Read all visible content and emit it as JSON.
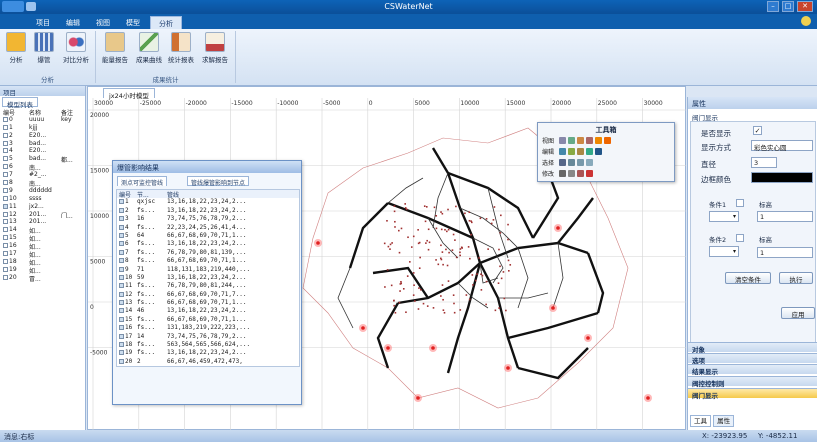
{
  "window": {
    "title": "CSWaterNet"
  },
  "tabs": [
    "项目",
    "编辑",
    "视图",
    "模型",
    "分析"
  ],
  "ribbon": {
    "buttons": [
      {
        "label": "分析",
        "icon": "analysis-icon",
        "color": "#f2b632"
      },
      {
        "label": "爆管",
        "icon": "pipe-burst-icon",
        "color": "#4a72b8"
      },
      {
        "label": "对比分析",
        "icon": "compare-icon",
        "color": "#d8486a"
      },
      {
        "label": "能量报告",
        "icon": "energy-report-icon",
        "color": "#e0a040"
      },
      {
        "label": "成果曲线",
        "icon": "result-curve-icon",
        "color": "#5aa050"
      },
      {
        "label": "统计报表",
        "icon": "stat-report-icon",
        "color": "#d07030"
      },
      {
        "label": "求解报告",
        "icon": "solve-report-icon",
        "color": "#c04040"
      }
    ],
    "groups": [
      "分析",
      "成果统计"
    ]
  },
  "left_panel": {
    "title": "项目",
    "tab": "模型列表",
    "headers": [
      "编号",
      "名称",
      "备注"
    ],
    "rows": [
      {
        "no": "0",
        "name": "uuuu",
        "note": "key",
        "checked": false
      },
      {
        "no": "1",
        "name": "kjjj",
        "note": "",
        "checked": false
      },
      {
        "no": "2",
        "name": "E20...",
        "note": "",
        "checked": false
      },
      {
        "no": "3",
        "name": "bad...",
        "note": "",
        "checked": false
      },
      {
        "no": "4",
        "name": "E20...",
        "note": "",
        "checked": false
      },
      {
        "no": "5",
        "name": "bad...",
        "note": "都...",
        "checked": false
      },
      {
        "no": "6",
        "name": "南...",
        "note": "",
        "checked": false
      },
      {
        "no": "7",
        "name": "#2_...",
        "note": "",
        "checked": false
      },
      {
        "no": "8",
        "name": "南...",
        "note": "",
        "checked": false
      },
      {
        "no": "9",
        "name": "dddddd",
        "note": "",
        "checked": false
      },
      {
        "no": "10",
        "name": "ssss",
        "note": "",
        "checked": false
      },
      {
        "no": "11",
        "name": "jx2...",
        "note": "",
        "checked": true
      },
      {
        "no": "12",
        "name": "201...",
        "note": "门...",
        "checked": false
      },
      {
        "no": "13",
        "name": "201...",
        "note": "",
        "checked": false
      },
      {
        "no": "14",
        "name": "如...",
        "note": "",
        "checked": false
      },
      {
        "no": "15",
        "name": "如...",
        "note": "",
        "checked": false
      },
      {
        "no": "16",
        "name": "如...",
        "note": "",
        "checked": false
      },
      {
        "no": "17",
        "name": "如...",
        "note": "",
        "checked": false
      },
      {
        "no": "18",
        "name": "如...",
        "note": "",
        "checked": false
      },
      {
        "no": "19",
        "name": "如...",
        "note": "",
        "checked": false
      },
      {
        "no": "20",
        "name": "冒...",
        "note": "",
        "checked": false
      }
    ]
  },
  "document": {
    "tab": "jx24小时模型",
    "x_ticks": [
      "30000",
      "-25000",
      "-20000",
      "-15000",
      "-10000",
      "-5000",
      "0",
      "5000",
      "10000",
      "15000",
      "20000",
      "25000",
      "30000",
      "35000"
    ],
    "y_ticks": [
      "20000",
      "15000",
      "10000",
      "5000",
      "0",
      "-5000"
    ]
  },
  "impact_panel": {
    "title": "爆管影响结果",
    "tabs": [
      "测点可监控管线",
      "管线爆管影响到节点"
    ],
    "headers": [
      "编号",
      "节...",
      "管线"
    ],
    "rows": [
      {
        "no": "1",
        "node": "qxjsc",
        "pipes": "13,16,18,22,23,24,2..."
      },
      {
        "no": "2",
        "node": "fs...",
        "pipes": "13,16,18,22,23,24,2..."
      },
      {
        "no": "3",
        "node": "16",
        "pipes": "73,74,75,76,78,79,2..."
      },
      {
        "no": "4",
        "node": "fs...",
        "pipes": "22,23,24,25,26,41,4..."
      },
      {
        "no": "5",
        "node": "64",
        "pipes": "66,67,68,69,70,71,1..."
      },
      {
        "no": "6",
        "node": "fs...",
        "pipes": "13,16,18,22,23,24,2..."
      },
      {
        "no": "7",
        "node": "fs...",
        "pipes": "76,78,79,80,81,139,..."
      },
      {
        "no": "8",
        "node": "fs...",
        "pipes": "66,67,68,69,70,71,1..."
      },
      {
        "no": "9",
        "node": "71",
        "pipes": "118,131,183,219,440,..."
      },
      {
        "no": "10",
        "node": "59",
        "pipes": "13,16,18,22,23,24,2..."
      },
      {
        "no": "11",
        "node": "fs...",
        "pipes": "76,78,79,80,81,244,..."
      },
      {
        "no": "12",
        "node": "fs...",
        "pipes": "66,67,68,69,70,71,7..."
      },
      {
        "no": "13",
        "node": "fs...",
        "pipes": "66,67,68,69,70,71,1..."
      },
      {
        "no": "14",
        "node": "46",
        "pipes": "13,16,18,22,23,24,2..."
      },
      {
        "no": "15",
        "node": "fs...",
        "pipes": "66,67,68,69,70,71,1..."
      },
      {
        "no": "16",
        "node": "fs...",
        "pipes": "131,183,219,222,223,..."
      },
      {
        "no": "17",
        "node": "14",
        "pipes": "73,74,75,76,78,79,2..."
      },
      {
        "no": "18",
        "node": "fs...",
        "pipes": "563,564,565,566,624,..."
      },
      {
        "no": "19",
        "node": "fs...",
        "pipes": "13,16,18,22,23,24,2..."
      },
      {
        "no": "20",
        "node": "2",
        "pipes": "66,67,46,459,472,473,"
      }
    ]
  },
  "toolbox": {
    "title": "工具箱",
    "rows": [
      "视图",
      "编辑",
      "选择",
      "修改"
    ]
  },
  "properties": {
    "title": "属性",
    "section": "阀门显示",
    "show_label": "是否显示",
    "show_mode_label": "显示方式",
    "show_mode_value": "彩色实心圆",
    "diameter_label": "直径",
    "diameter_value": "3",
    "border_color_label": "边框颜色",
    "border_color": "#000000",
    "cond1_label": "条件1",
    "cond2_label": "条件2",
    "level_label": "标高",
    "cond1_value": "1",
    "cond2_value": "1",
    "clear_button": "清空条件",
    "exec_button": "执行",
    "apply_button": "应用",
    "accordion": [
      "对象",
      "选项",
      "结果显示",
      "阀控控制则",
      "阀门显示"
    ],
    "bottom_tabs": [
      "工具",
      "属性"
    ]
  },
  "status": {
    "message": "消息:右标",
    "x_coord": "X: -23923.95",
    "y_coord": "Y: -4852.11"
  }
}
